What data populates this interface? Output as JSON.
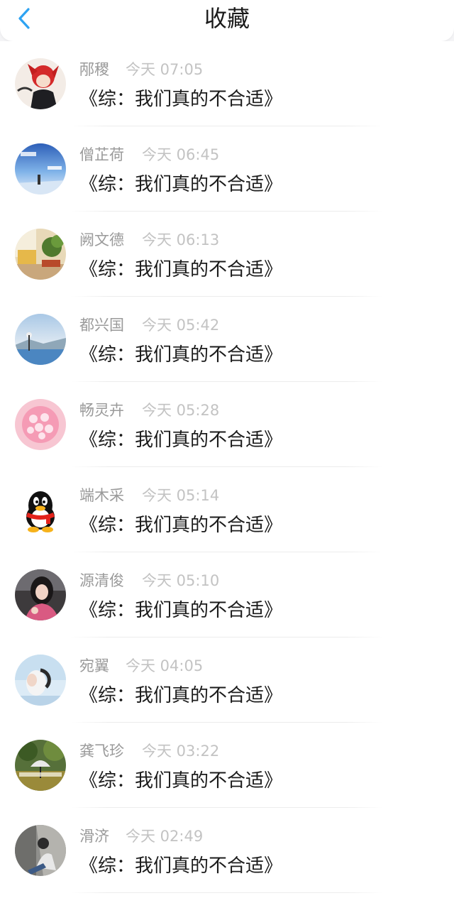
{
  "header": {
    "title": "收藏",
    "accent_color": "#2ea3f2"
  },
  "items": [
    {
      "name": "邴稷",
      "time": "今天 07:05",
      "book": "《综：我们真的不合适》"
    },
    {
      "name": "僧芷荷",
      "time": "今天 06:45",
      "book": "《综：我们真的不合适》"
    },
    {
      "name": "阙文德",
      "time": "今天 06:13",
      "book": "《综：我们真的不合适》"
    },
    {
      "name": "都兴国",
      "time": "今天 05:42",
      "book": "《综：我们真的不合适》"
    },
    {
      "name": "畅灵卉",
      "time": "今天 05:28",
      "book": "《综：我们真的不合适》"
    },
    {
      "name": "端木采",
      "time": "今天 05:14",
      "book": "《综：我们真的不合适》"
    },
    {
      "name": "源清俊",
      "time": "今天 05:10",
      "book": "《综：我们真的不合适》"
    },
    {
      "name": "宛翼",
      "time": "今天 04:05",
      "book": "《综：我们真的不合适》"
    },
    {
      "name": "龚飞珍",
      "time": "今天 03:22",
      "book": "《综：我们真的不合适》"
    },
    {
      "name": "滑济",
      "time": "今天 02:49",
      "book": "《综：我们真的不合适》"
    }
  ]
}
